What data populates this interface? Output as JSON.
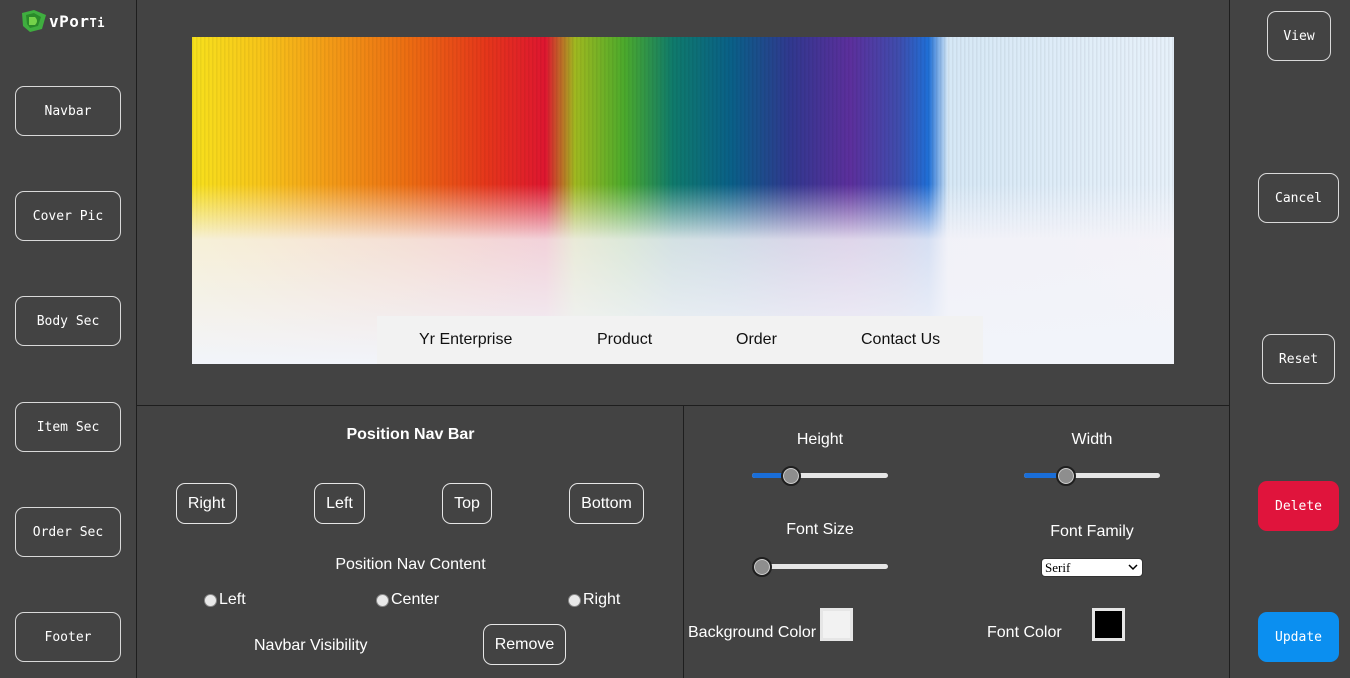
{
  "app": {
    "logo_text_main": "vPor",
    "logo_text_tail": "Ti",
    "logo_text_end": ""
  },
  "sidebar_left": {
    "items": [
      "Navbar",
      "Cover Pic",
      "Body Sec",
      "Item Sec",
      "Order Sec",
      "Footer"
    ]
  },
  "sidebar_right": {
    "view": "View",
    "cancel": "Cancel",
    "reset": "Reset",
    "delete": "Delete",
    "update": "Update"
  },
  "preview": {
    "nav_items": [
      "Yr Enterprise",
      "Product",
      "Order",
      "Contact Us"
    ]
  },
  "position_panel": {
    "title": "Position Nav Bar",
    "buttons": [
      "Right",
      "Left",
      "Top",
      "Bottom"
    ],
    "content_title": "Position Nav Content",
    "radios": [
      "Left",
      "Center",
      "Right"
    ],
    "visibility_label": "Navbar Visibility",
    "remove_label": "Remove"
  },
  "style_panel": {
    "height_label": "Height",
    "width_label": "Width",
    "font_size_label": "Font Size",
    "font_family_label": "Font Family",
    "font_family_value": "Serif",
    "bg_color_label": "Background Color",
    "font_color_label": "Font Color",
    "height_value": 0.25,
    "width_value": 0.28,
    "font_size_value": 0.0,
    "bg_color": "#f2f2f2",
    "font_color": "#000000",
    "slider_fill_color": "#1a6ed8"
  },
  "colors": {
    "delete": "#e0143c",
    "update": "#0b8ff0",
    "background": "#434343"
  }
}
